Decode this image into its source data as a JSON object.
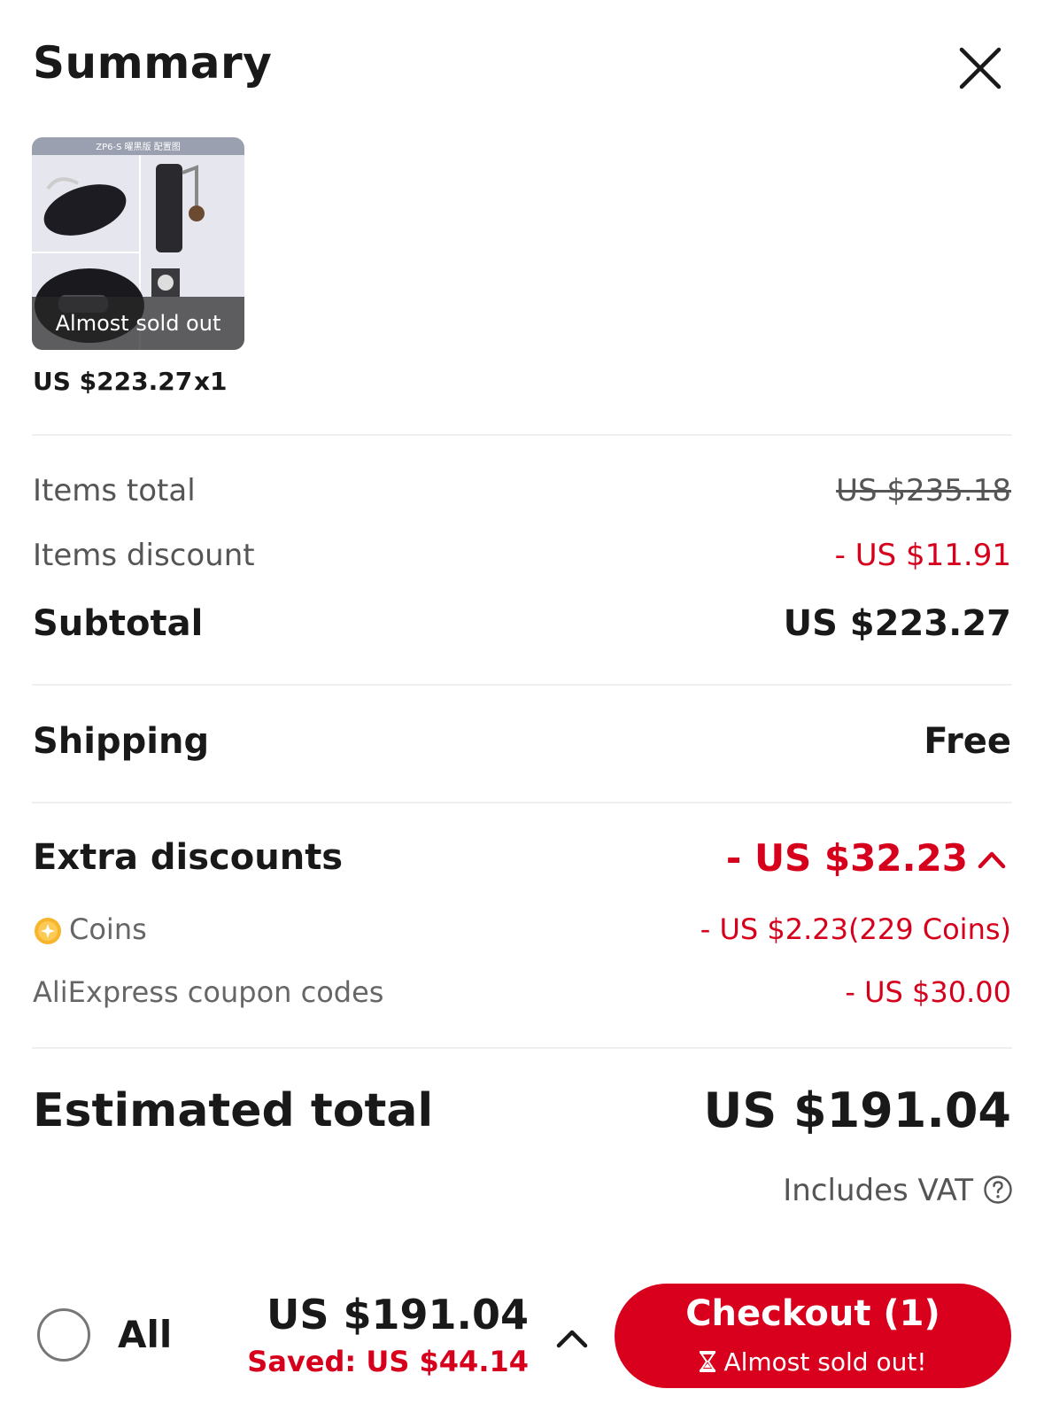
{
  "header": {
    "title": "Summary"
  },
  "product": {
    "image_caption": "ZP6-S 曜黑版 配置图",
    "badge": "Almost sold out",
    "price": "US $223.27",
    "qty": "x1"
  },
  "summary": {
    "items_total_label": "Items total",
    "items_total_value": "US $235.18",
    "items_discount_label": "Items discount",
    "items_discount_value": "- US $11.91",
    "subtotal_label": "Subtotal",
    "subtotal_value": "US $223.27",
    "shipping_label": "Shipping",
    "shipping_value": "Free",
    "extra_discounts_label": "Extra discounts",
    "extra_discounts_value": "- US $32.23",
    "coins_label": "Coins",
    "coins_value": "- US $2.23(229 Coins)",
    "coupon_label": "AliExpress coupon codes",
    "coupon_value": "- US $30.00",
    "estimated_total_label": "Estimated total",
    "estimated_total_value": "US $191.04",
    "vat_note": "Includes VAT"
  },
  "bottom_bar": {
    "all_label": "All",
    "total": "US $191.04",
    "saved": "Saved: US $44.14",
    "checkout_label": "Checkout (1)",
    "checkout_sub": "Almost sold out!"
  },
  "colors": {
    "accent_red": "#d6001c",
    "button_red": "#d8001c"
  },
  "icons": [
    "close-icon",
    "coin-icon",
    "chevron-up-icon",
    "help-icon",
    "hourglass-icon"
  ]
}
